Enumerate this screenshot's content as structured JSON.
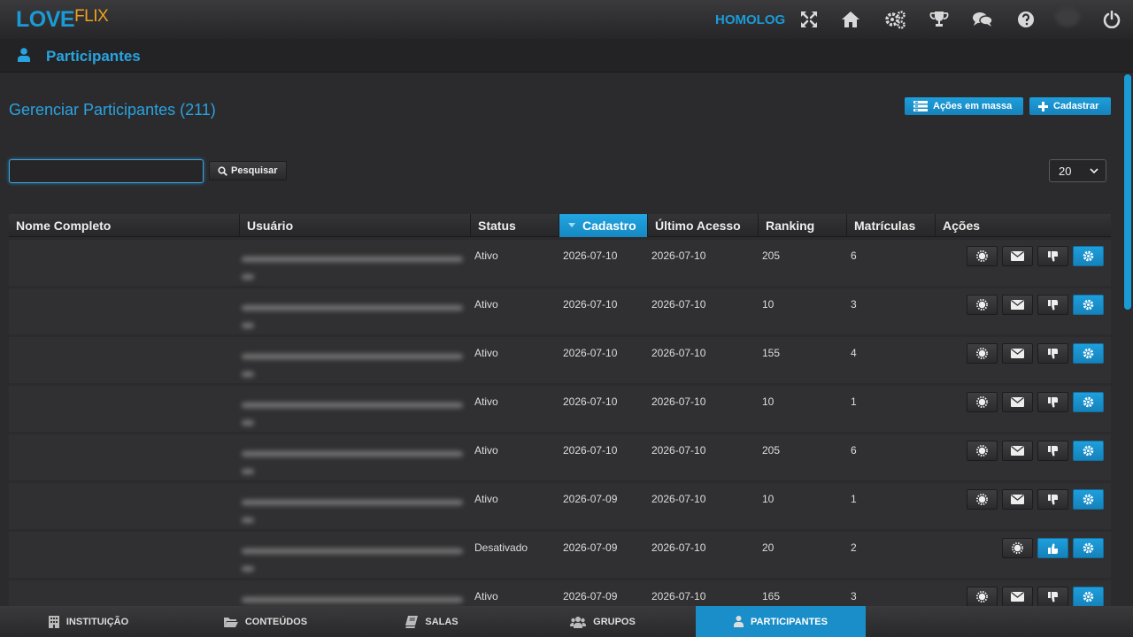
{
  "header": {
    "logo_love": "LOVE",
    "logo_flix": "FLIX",
    "environment": "HOMOLOG",
    "icons": [
      "fullscreen-icon",
      "home-icon",
      "gears-icon",
      "trophy-icon",
      "chat-icon",
      "help-icon",
      "power-icon"
    ]
  },
  "subheader": {
    "title": "Participantes"
  },
  "main": {
    "heading": "Gerenciar Participantes (211)",
    "bulk_actions_label": "Ações em massa",
    "register_label": "Cadastrar",
    "search_value": "",
    "search_button_label": "Pesquisar",
    "page_size": "20"
  },
  "table": {
    "columns": [
      "Nome Completo",
      "Usuário",
      "Status",
      "Cadastro",
      "Último Acesso",
      "Ranking",
      "Matrículas",
      "Ações"
    ],
    "sorted_column": "Cadastro",
    "rows": [
      {
        "name": "",
        "user": "",
        "status": "Ativo",
        "created": "2026-07-10",
        "last_access": "2026-07-10",
        "ranking": "205",
        "enrollments": "6"
      },
      {
        "name": "",
        "user": "",
        "status": "Ativo",
        "created": "2026-07-10",
        "last_access": "2026-07-10",
        "ranking": "10",
        "enrollments": "3"
      },
      {
        "name": "",
        "user": "",
        "status": "Ativo",
        "created": "2026-07-10",
        "last_access": "2026-07-10",
        "ranking": "155",
        "enrollments": "4"
      },
      {
        "name": "",
        "user": "",
        "status": "Ativo",
        "created": "2026-07-10",
        "last_access": "2026-07-10",
        "ranking": "10",
        "enrollments": "1"
      },
      {
        "name": "",
        "user": "",
        "status": "Ativo",
        "created": "2026-07-10",
        "last_access": "2026-07-10",
        "ranking": "205",
        "enrollments": "6"
      },
      {
        "name": "",
        "user": "",
        "status": "Ativo",
        "created": "2026-07-09",
        "last_access": "2026-07-10",
        "ranking": "10",
        "enrollments": "1"
      },
      {
        "name": "",
        "user": "",
        "status": "Desativado",
        "created": "2026-07-09",
        "last_access": "2026-07-10",
        "ranking": "20",
        "enrollments": "2"
      },
      {
        "name": "",
        "user": "",
        "status": "Ativo",
        "created": "2026-07-09",
        "last_access": "2026-07-10",
        "ranking": "165",
        "enrollments": "3"
      }
    ]
  },
  "bottom_nav": {
    "items": [
      {
        "label": "INSTITUIÇÃO",
        "icon": "building-icon"
      },
      {
        "label": "CONTEÚDOS",
        "icon": "folder-icon"
      },
      {
        "label": "SALAS",
        "icon": "book-icon"
      },
      {
        "label": "GRUPOS",
        "icon": "users-icon"
      },
      {
        "label": "PARTICIPANTES",
        "icon": "user-icon"
      }
    ],
    "active": "PARTICIPANTES"
  },
  "colors": {
    "accent": "#1a9bd8",
    "logo_secondary": "#f0a01e",
    "background": "#2b2b2d"
  }
}
